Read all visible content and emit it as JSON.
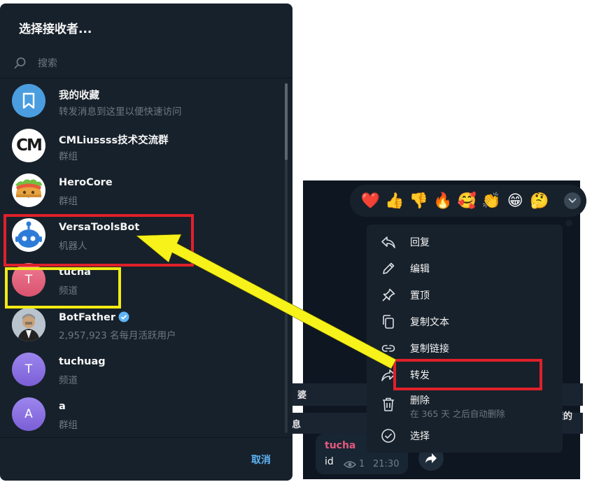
{
  "dialog": {
    "title": "选择接收者...",
    "search_placeholder": "搜索",
    "cancel_label": "取消",
    "chats": [
      {
        "name": "我的收藏",
        "subtitle": "转发消息到这里以便快速访问",
        "avatar": "bookmark-icon",
        "avatar_color": "#4a9ee0"
      },
      {
        "name": "CMLiussss技术交流群",
        "subtitle": "群组",
        "avatar_text": "CM",
        "avatar_color": "#ffffff"
      },
      {
        "name": "HeroCore",
        "subtitle": "群组",
        "avatar": "taco-icon",
        "avatar_color": "#ffffff"
      },
      {
        "name": "VersaToolsBot",
        "subtitle": "机器人",
        "avatar": "robot-icon",
        "avatar_color": "#ffffff"
      },
      {
        "name": "tucha",
        "subtitle": "频道",
        "avatar_text": "T",
        "avatar_color": "#e06a85"
      },
      {
        "name": "BotFather",
        "subtitle": "2,957,923 名每月活跃用户",
        "avatar": "botfather-avatar",
        "verified": true,
        "avatar_color": "#cfd6de"
      },
      {
        "name": "tuchuag",
        "subtitle": "频道",
        "avatar_text": "T",
        "avatar_color": "#8b6fe0"
      },
      {
        "name": "a",
        "subtitle": "群组",
        "avatar_text": "A",
        "avatar_color": "#8b6fe0"
      }
    ]
  },
  "message": {
    "sender": "tucha",
    "text": "id",
    "views": "1",
    "time": "21:30",
    "sender_color": "#e5597e"
  },
  "background_fragments": {
    "left1": "婆",
    "left2": "息",
    "right2": "懂的"
  },
  "reactions": [
    "❤️",
    "👍",
    "👎",
    "🔥",
    "🥰",
    "👏",
    "😁",
    "🤔"
  ],
  "context_menu": {
    "items": [
      {
        "label": "回复",
        "icon": "reply-icon"
      },
      {
        "label": "编辑",
        "icon": "pencil-icon"
      },
      {
        "label": "置顶",
        "icon": "pin-icon"
      },
      {
        "label": "复制文本",
        "icon": "copy-icon"
      },
      {
        "label": "复制链接",
        "icon": "link-icon"
      },
      {
        "label": "转发",
        "icon": "forward-icon"
      },
      {
        "label": "删除",
        "sublabel": "在 365 天 之后自动删除",
        "icon": "trash-icon"
      },
      {
        "label": "选择",
        "icon": "check-circle-icon"
      }
    ]
  },
  "annotation_colors": {
    "red": "#e0202a",
    "yellow": "#f2ea14"
  }
}
